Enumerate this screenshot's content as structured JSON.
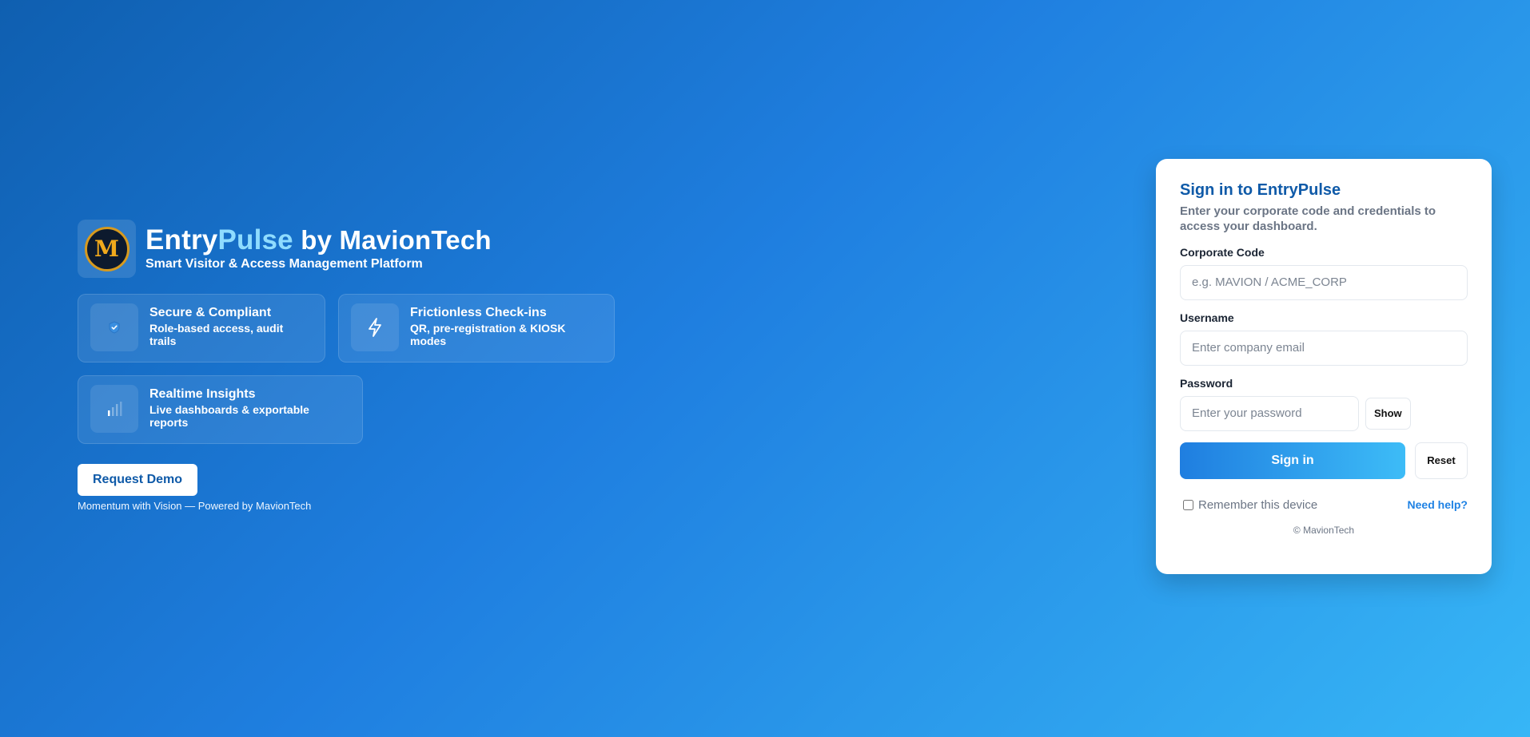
{
  "brand": {
    "title_part1": "Entry",
    "title_part2": "Pulse",
    "title_part3": " by MavionTech",
    "subtitle": "Smart Visitor & Access Management Platform",
    "logo_letter": "M"
  },
  "features": [
    {
      "icon": "shield-check-icon",
      "title": "Secure & Compliant",
      "desc": "Role-based access, audit trails"
    },
    {
      "icon": "lightning-icon",
      "title": "Frictionless Check-ins",
      "desc": "QR, pre-registration & KIOSK modes"
    },
    {
      "icon": "bar-chart-icon",
      "title": "Realtime Insights",
      "desc": "Live dashboards & exportable reports"
    }
  ],
  "demo_button": "Request Demo",
  "powered_by": "Momentum with Vision — Powered by MavionTech",
  "login": {
    "heading": "Sign in to EntryPulse",
    "intro": "Enter your corporate code and credentials to access your dashboard.",
    "corporate_label": "Corporate Code",
    "corporate_placeholder": "e.g. MAVION / ACME_CORP",
    "username_label": "Username",
    "username_placeholder": "Enter company email",
    "password_label": "Password",
    "password_placeholder": "Enter your password",
    "show_label": "Show",
    "signin_label": "Sign in",
    "reset_label": "Reset",
    "remember_label": "Remember this device",
    "help_label": "Need help?",
    "copyright": "© MavionTech"
  },
  "colors": {
    "accent": "#0f5aa8",
    "accent_light": "#8fdcff",
    "gradient_start": "#0f5fb0",
    "gradient_end": "#37b6f6"
  }
}
